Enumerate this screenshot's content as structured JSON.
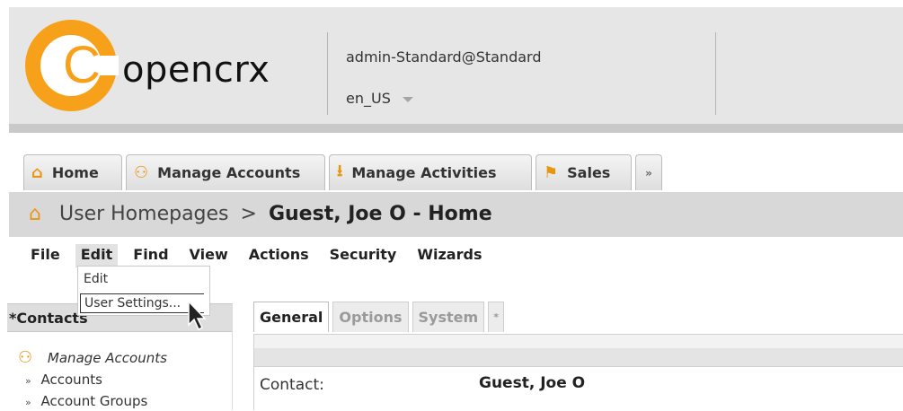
{
  "header": {
    "logo_text": "opencrx",
    "user": "admin-Standard@Standard",
    "locale": "en_US"
  },
  "tabs": [
    {
      "label": "Home",
      "icon": "home-icon"
    },
    {
      "label": "Manage Accounts",
      "icon": "people-icon"
    },
    {
      "label": "Manage Activities",
      "icon": "download-tray-icon"
    },
    {
      "label": "Sales",
      "icon": "flag-icon"
    },
    {
      "label": "»",
      "icon": "more-icon"
    }
  ],
  "breadcrumb": {
    "parent": "User Homepages",
    "separator": ">",
    "current": "Guest, Joe O - Home"
  },
  "menu": {
    "items": [
      "File",
      "Edit",
      "Find",
      "View",
      "Actions",
      "Security",
      "Wizards"
    ],
    "open_dropdown": {
      "items": [
        "Edit",
        "User Settings..."
      ]
    }
  },
  "left_panel": {
    "title": "*Contacts",
    "group": "Manage Accounts",
    "links": [
      "Accounts",
      "Account Groups"
    ],
    "bullet": "»"
  },
  "right_panel": {
    "subtabs": [
      "General",
      "Options",
      "System",
      "*"
    ],
    "field_label": "Contact:",
    "field_value": "Guest, Joe O"
  },
  "colors": {
    "accent": "#f7a11a",
    "header_bg": "#e6e6e6",
    "crumb_bg": "#d8d8d8"
  }
}
